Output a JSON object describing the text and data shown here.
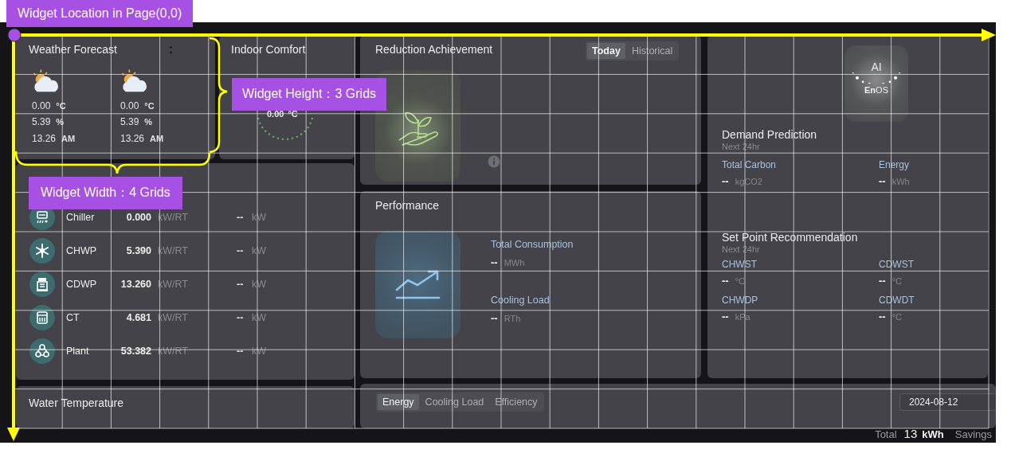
{
  "annotations": {
    "location_label": "Widget Location in Page(0,0)",
    "height_label": "Widget Height：3 Grids",
    "width_label": "Widget Width：4 Grids"
  },
  "weather_forecast": {
    "title": "Weather Forecast",
    "days": [
      {
        "temperature": "0.00",
        "temperature_unit": "°C",
        "humidity": "5.39",
        "humidity_unit": "%",
        "time": "13.26",
        "time_unit": "AM"
      },
      {
        "temperature": "0.00",
        "temperature_unit": "°C",
        "humidity": "5.39",
        "humidity_unit": "%",
        "time": "13.26",
        "time_unit": "AM"
      }
    ]
  },
  "indoor_comfort": {
    "title": "Indoor Comfort",
    "value": "0.00",
    "unit": "°C"
  },
  "equipment": [
    {
      "kind": "chiller",
      "name": "Chiller",
      "efficiency": "0.000",
      "efficiency_unit": "kW/RT",
      "power": "--",
      "power_unit": "kW"
    },
    {
      "kind": "chilled_water_pump",
      "name": "CHWP",
      "efficiency": "5.390",
      "efficiency_unit": "kW/RT",
      "power": "--",
      "power_unit": "kW"
    },
    {
      "kind": "condenser_water_pump",
      "name": "CDWP",
      "efficiency": "13.260",
      "efficiency_unit": "kW/RT",
      "power": "--",
      "power_unit": "kW"
    },
    {
      "kind": "cooling_tower",
      "name": "CT",
      "efficiency": "4.681",
      "efficiency_unit": "kW/RT",
      "power": "--",
      "power_unit": "kW"
    },
    {
      "kind": "plant",
      "name": "Plant",
      "efficiency": "53.382",
      "efficiency_unit": "kW/RT",
      "power": "--",
      "power_unit": "kW"
    }
  ],
  "water_temperature": {
    "title": "Water Temperature"
  },
  "reduction_achievement": {
    "title": "Reduction Achievement",
    "tabs": [
      {
        "label": "Today",
        "selected": true
      },
      {
        "label": "Historical",
        "selected": false
      }
    ]
  },
  "performance": {
    "title": "Performance",
    "metrics": [
      {
        "label": "Total Consumption",
        "value": "--",
        "unit": "MWh"
      },
      {
        "label": "Cooling Load",
        "value": "--",
        "unit": "RTh"
      }
    ]
  },
  "ai_panel": {
    "logo_top": "AI",
    "logo_bottom": "**En**OS",
    "demand_prediction": {
      "title": "Demand Prediction",
      "subtitle": "Next 24hr",
      "metrics": [
        {
          "label": "Total Carbon",
          "value": "--",
          "unit": "kgCO2"
        },
        {
          "label": "Energy",
          "value": "--",
          "unit": "kWh"
        }
      ]
    },
    "set_point_recommendation": {
      "title": "Set Point Recommendation",
      "subtitle": "Next 24hr",
      "metrics": [
        {
          "label": "CHWST",
          "value": "--",
          "unit": "°C"
        },
        {
          "label": "CDWST",
          "value": "--",
          "unit": "°C"
        },
        {
          "label": "CHWDP",
          "value": "--",
          "unit": "kPa"
        },
        {
          "label": "CDWDT",
          "value": "--",
          "unit": "°C"
        }
      ]
    }
  },
  "bottom_bar": {
    "tabs": [
      {
        "label": "Energy",
        "selected": true
      },
      {
        "label": "Cooling Load",
        "selected": false
      },
      {
        "label": "Efficiency",
        "selected": false
      }
    ],
    "date": "2024-08-12",
    "summary": {
      "total_label": "Total",
      "total_value": "13",
      "total_unit": "kWh",
      "savings_label": "Savings"
    }
  }
}
